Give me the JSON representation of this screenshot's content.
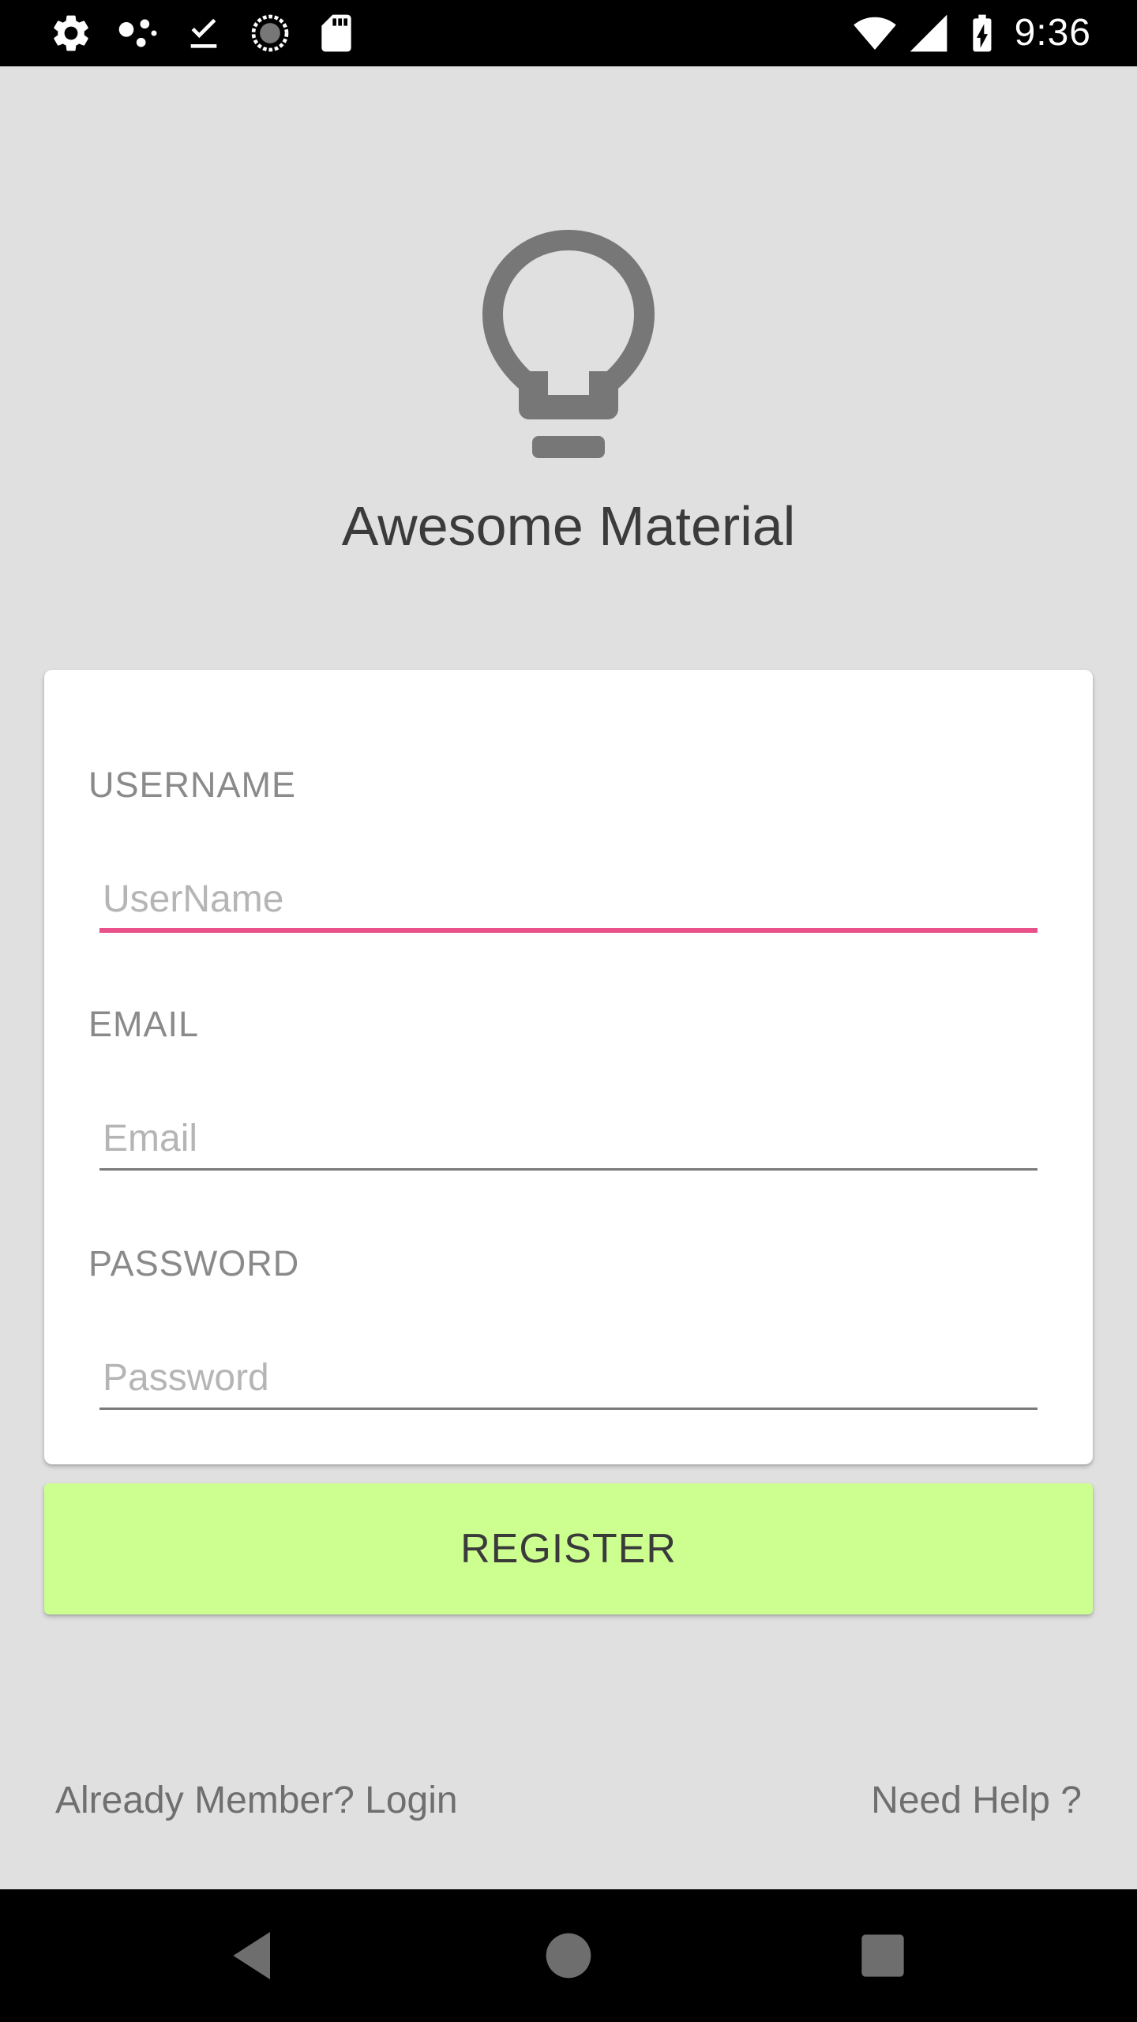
{
  "status_bar": {
    "time": "9:36",
    "left_icons": [
      "gear-icon",
      "dots-icon",
      "download-done-icon",
      "sync-icon",
      "sd-card-icon"
    ],
    "right_icons": [
      "wifi-icon",
      "signal-icon",
      "battery-charging-icon"
    ]
  },
  "app": {
    "logo_icon": "lightbulb-icon",
    "title": "Awesome Material"
  },
  "form": {
    "username": {
      "label": "USERNAME",
      "placeholder": "UserName",
      "value": ""
    },
    "email": {
      "label": "EMAIL",
      "placeholder": "Email",
      "value": ""
    },
    "password": {
      "label": "PASSWORD",
      "placeholder": "Password",
      "value": ""
    },
    "active_field": "username"
  },
  "register_button": {
    "label": "REGISTER"
  },
  "footer": {
    "login_link": "Already Member? Login",
    "help_link": "Need Help ?"
  },
  "nav_bar": {
    "icons": [
      "back-icon",
      "home-icon",
      "recents-icon"
    ]
  },
  "colors": {
    "background": "#e0e0e0",
    "accent": "#e8518a",
    "register_button": "#ccff90",
    "logo": "#777777",
    "title": "#3b3b3b"
  }
}
